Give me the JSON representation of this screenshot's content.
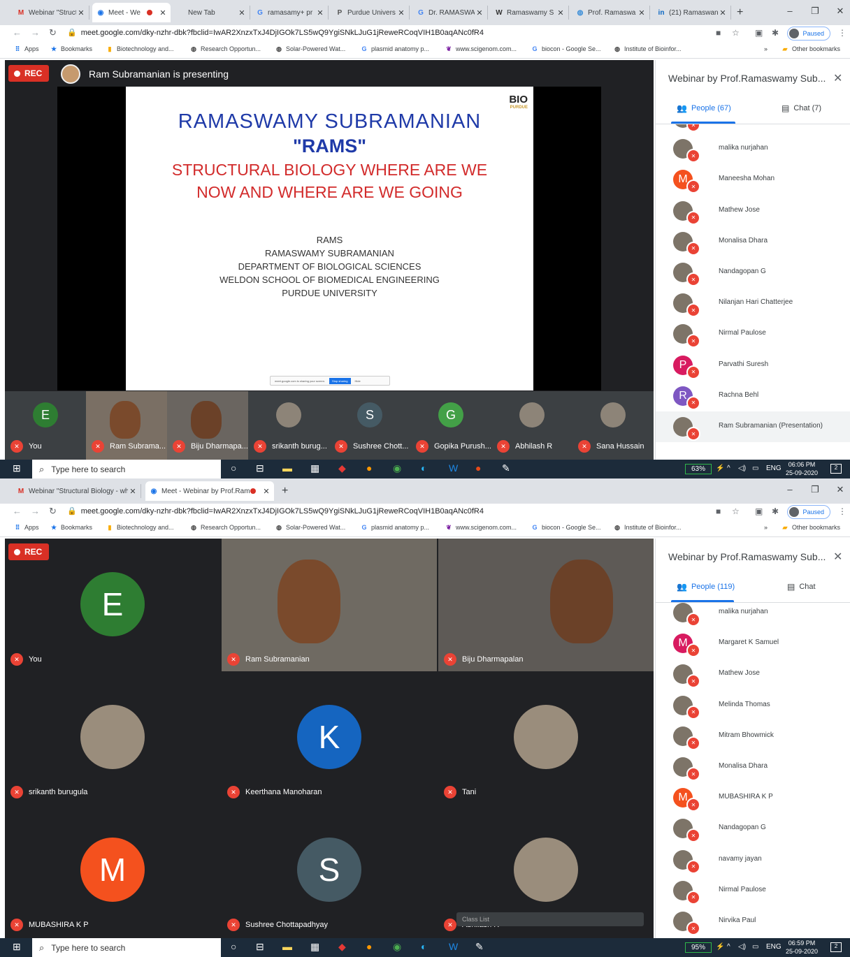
{
  "browser": {
    "url": "meet.google.com/dky-nzhr-dbk?fbclid=IwAR2XnzxTxJ4DjIGOk7LS5wQ9YgiSNkLJuG1jReweRCoqVIH1B0aqANc0fR4",
    "paused_label": "Paused",
    "bookmarks": [
      {
        "label": "Apps",
        "icon": "apps-icon"
      },
      {
        "label": "Bookmarks",
        "icon": "star-icon"
      },
      {
        "label": "Biotechnology and...",
        "icon": "bookmark-icon"
      },
      {
        "label": "Research Opportun...",
        "icon": "globe-icon"
      },
      {
        "label": "Solar-Powered Wat...",
        "icon": "globe-icon"
      },
      {
        "label": "plasmid anatomy p...",
        "icon": "google-icon"
      },
      {
        "label": "www.scigenom.com...",
        "icon": "leaf-icon"
      },
      {
        "label": "biocon - Google Se...",
        "icon": "google-icon"
      },
      {
        "label": "Institute of Bioinfor...",
        "icon": "globe-icon"
      }
    ],
    "bookmarks_more": "»",
    "other_bookmarks": "Other bookmarks"
  },
  "screen1": {
    "tabs": [
      {
        "label": "Webinar \"Struct",
        "icon": "gmail-icon"
      },
      {
        "label": "Meet - We",
        "icon": "meet-icon",
        "active": true,
        "recording": true
      },
      {
        "label": "New Tab",
        "icon": ""
      },
      {
        "label": "ramasamy+ pr",
        "icon": "google-icon"
      },
      {
        "label": "Purdue Univers",
        "icon": "purdue-icon"
      },
      {
        "label": "Dr. RAMASWA",
        "icon": "google-icon"
      },
      {
        "label": "Ramaswamy S",
        "icon": "wikipedia-icon"
      },
      {
        "label": "Prof. Ramaswa",
        "icon": "globe-icon"
      },
      {
        "label": "(21) Ramaswan",
        "icon": "linkedin-icon"
      }
    ],
    "rec_label": "REC",
    "presenting_text": "Ram Subramanian is presenting",
    "slide": {
      "name": "RAMASWAMY SUBRAMANIAN",
      "nickname": "\"RAMS\"",
      "title_line1": "STRUCTURAL BIOLOGY WHERE ARE WE",
      "title_line2": "NOW AND WHERE ARE WE GOING",
      "affiliation": [
        "RAMS",
        "RAMASWAMY SUBRAMANIAN",
        "DEPARTMENT OF BIOLOGICAL SCIENCES",
        "WELDON SCHOOL OF BIOMEDICAL ENGINEERING",
        "PURDUE UNIVERSITY"
      ],
      "logo_text": "BIO",
      "logo_sub": "PURDUE",
      "share_notice": "meet.google.com is sharing your screen.",
      "share_stop": "Stop sharing",
      "share_hide": "Hide"
    },
    "strip": [
      {
        "name": "You",
        "initial": "E",
        "color": "#2e7d32"
      },
      {
        "name": "Ram Subrama...",
        "video": true
      },
      {
        "name": "Biju Dharmapa...",
        "video": true
      },
      {
        "name": "srikanth burug...",
        "photo": true
      },
      {
        "name": "Sushree Chott...",
        "initial": "S",
        "color": "#455a64"
      },
      {
        "name": "Gopika Purush...",
        "initial": "G",
        "color": "#43a047"
      },
      {
        "name": "Abhilash R",
        "photo": true
      },
      {
        "name": "Sana Hussain",
        "photo": true
      }
    ],
    "panel": {
      "title": "Webinar by Prof.Ramaswamy Sub...",
      "people_tab": "People (67)",
      "chat_tab": "Chat (7)",
      "people": [
        {
          "name": "",
          "photo": true
        },
        {
          "name": "malika nurjahan",
          "photo": true
        },
        {
          "name": "Maneesha Mohan",
          "initial": "M",
          "color": "#f4511e"
        },
        {
          "name": "Mathew Jose",
          "photo": true
        },
        {
          "name": "Monalisa Dhara",
          "photo": true
        },
        {
          "name": "Nandagopan G",
          "photo": true
        },
        {
          "name": "Nilanjan Hari Chatterjee",
          "photo": true
        },
        {
          "name": "Nirmal Paulose",
          "photo": true
        },
        {
          "name": "Parvathi Suresh",
          "initial": "P",
          "color": "#d81b60"
        },
        {
          "name": "Rachna Behl",
          "initial": "R",
          "color": "#7e57c2"
        },
        {
          "name": "Ram Subramanian (Presentation)",
          "photo": true,
          "selected": true
        }
      ]
    },
    "taskbar": {
      "search": "Type here to search",
      "battery": "63%",
      "lang": "ENG",
      "time": "06:06 PM",
      "date": "25-09-2020",
      "notif": "2"
    }
  },
  "screen2": {
    "tabs": [
      {
        "label": "Webinar \"Structural Biology - whe",
        "icon": "gmail-icon"
      },
      {
        "label": "Meet - Webinar by Prof.Ramo",
        "icon": "meet-icon",
        "active": true,
        "recording": true
      }
    ],
    "rec_label": "REC",
    "grid": [
      {
        "name": "You",
        "initial": "E",
        "color": "#2e7d32"
      },
      {
        "name": "Ram Subramanian",
        "video": true
      },
      {
        "name": "Biju Dharmapalan",
        "video": true
      },
      {
        "name": "srikanth burugula",
        "photo": true
      },
      {
        "name": "Keerthana Manoharan",
        "initial": "K",
        "color": "#1565c0"
      },
      {
        "name": "Tani",
        "photo": true
      },
      {
        "name": "MUBASHIRA K P",
        "initial": "M",
        "color": "#f4511e"
      },
      {
        "name": "Sushree Chottapadhyay",
        "initial": "S",
        "color": "#455a64"
      },
      {
        "name": "Abhilash R",
        "photo": true
      }
    ],
    "captions_label": "Class List",
    "panel": {
      "title": "Webinar by Prof.Ramaswamy Sub...",
      "people_tab": "People (119)",
      "chat_tab": "Chat",
      "people": [
        {
          "name": "malika nurjahan",
          "photo": true
        },
        {
          "name": "Margaret K Samuel",
          "initial": "M",
          "color": "#d81b60"
        },
        {
          "name": "Mathew Jose",
          "photo": true
        },
        {
          "name": "Melinda Thomas",
          "photo": true
        },
        {
          "name": "Mitram Bhowmick",
          "photo": true
        },
        {
          "name": "Monalisa Dhara",
          "photo": true
        },
        {
          "name": "MUBASHIRA K P",
          "initial": "M",
          "color": "#f4511e"
        },
        {
          "name": "Nandagopan G",
          "photo": true
        },
        {
          "name": "navamy jayan",
          "photo": true
        },
        {
          "name": "Nirmal Paulose",
          "photo": true
        },
        {
          "name": "Nirvika Paul",
          "photo": true
        }
      ]
    },
    "taskbar": {
      "search": "Type here to search",
      "battery": "95%",
      "lang": "ENG",
      "time": "06:59 PM",
      "date": "25-09-2020",
      "notif": "2"
    }
  }
}
